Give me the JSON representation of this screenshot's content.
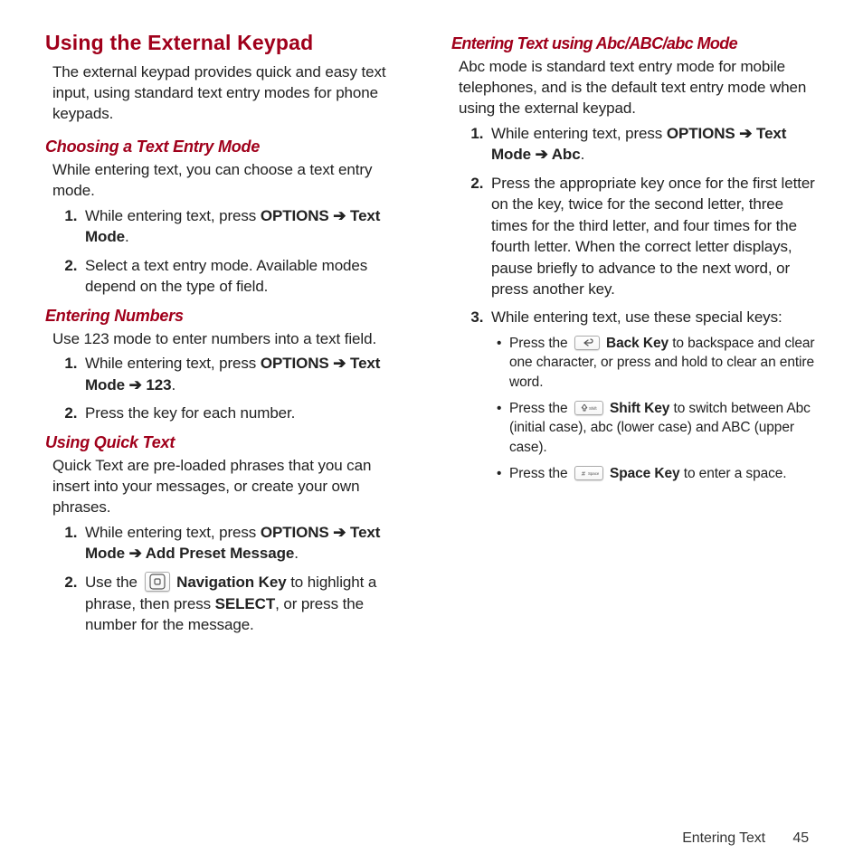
{
  "left": {
    "h1": "Using the External Keypad",
    "intro": "The external keypad provides quick and easy text input, using standard text entry modes for phone keypads.",
    "sec_choose": {
      "title": "Choosing a Text Entry Mode",
      "body": "While entering text, you can choose a text entry mode.",
      "s1a": "While entering text, press ",
      "s1b_strong": "OPTIONS ➔ Text Mode",
      "s1c": ".",
      "s2": "Select a text entry mode. Available modes depend on the type of field."
    },
    "sec_num": {
      "title": "Entering Numbers",
      "body": "Use 123 mode to enter numbers into a text field.",
      "s1a": "While entering text, press ",
      "s1b_strong": "OPTIONS ➔ Text Mode ➔ 123",
      "s1c": ".",
      "s2": "Press the key for each number."
    },
    "sec_qt": {
      "title": "Using Quick Text",
      "body": "Quick Text are pre-loaded phrases that you can insert into your messages, or create your own phrases.",
      "s1a": "While entering text, press ",
      "s1b_strong": "OPTIONS ➔ Text Mode ➔ Add Preset Message",
      "s1c": ".",
      "s2a": "Use the ",
      "s2key": "Navigation Key",
      "s2b": " to highlight a phrase, then press ",
      "s2sel": "SELECT",
      "s2c": ", or press the number for the message."
    }
  },
  "right": {
    "sec_abc": {
      "title": "Entering Text using Abc/ABC/abc Mode",
      "body": "Abc mode is standard text entry mode for mobile telephones, and is the default text entry mode when using the external keypad.",
      "s1a": "While entering text, press ",
      "s1b_strong": "OPTIONS ➔ Text Mode ➔ Abc",
      "s1c": ".",
      "s2": "Press the appropriate key once for the first letter on the key, twice for the second letter, three times for the third letter, and four times for the fourth letter. When the correct letter displays, pause briefly to advance to the next word, or press another key.",
      "s3": "While entering text, use these special keys:",
      "b1a": "Press the ",
      "b1key": "Back Key",
      "b1b": " to backspace and clear one character, or press and hold to clear an entire word.",
      "b2a": "Press the ",
      "b2key": "Shift Key",
      "b2b": " to switch between Abc (initial case), abc (lower case) and ABC (upper case).",
      "b3a": "Press the ",
      "b3key": "Space Key",
      "b3b": " to enter a space."
    }
  },
  "footer": {
    "section": "Entering Text",
    "page": "45"
  }
}
